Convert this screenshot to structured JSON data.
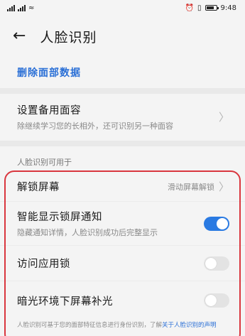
{
  "status_bar": {
    "left_text": "⁴⁶",
    "right_icons": "⏰ ⚡",
    "time": "9:48"
  },
  "header": {
    "back": "←",
    "title": "人脸识别"
  },
  "actions": {
    "delete_face_data": "删除面部数据"
  },
  "backup": {
    "title": "设置备用面容",
    "subtitle": "除继续学习您的长相外，还可识别另一种面容"
  },
  "section": {
    "label": "人脸识别可用于"
  },
  "options": {
    "unlock_screen": {
      "title": "解锁屏幕",
      "value": "滑动屏幕解锁"
    },
    "smart_notifications": {
      "title": "智能显示锁屏通知",
      "subtitle": "隐藏通知详情，人脸识别成功后完整显示",
      "enabled": true
    },
    "app_lock": {
      "title": "访问应用锁",
      "enabled": false
    },
    "low_light_fill": {
      "title": "暗光环境下屏幕补光",
      "enabled": false
    }
  },
  "footer": {
    "note": "人脸识别可基于您的面部特征信息进行身份识别，了解",
    "link": "关于人脸识别的声明"
  },
  "colors": {
    "accent": "#2a6fd6",
    "highlight_border": "#d9363e"
  }
}
